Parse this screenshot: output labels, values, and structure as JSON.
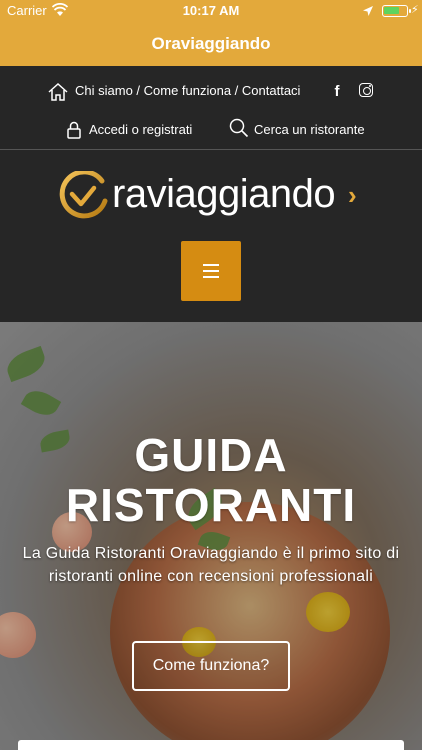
{
  "status_bar": {
    "carrier": "Carrier",
    "time": "10:17 AM"
  },
  "nav": {
    "title": "Oraviaggiando"
  },
  "header": {
    "links": "Chi siamo / Come funziona / Contattaci",
    "login": "Accedi o registrati",
    "search": "Cerca un ristorante",
    "logo_text": "raviaggiando"
  },
  "hero": {
    "title_line1": "GUIDA",
    "title_line2": "RISTORANTI",
    "subtitle": "La Guida Ristoranti Oraviaggiando è il primo sito di ristoranti online con recensioni professionali",
    "cta": "Come funziona?"
  },
  "colors": {
    "gold": "#e3a93b",
    "menu_button": "#d58c12",
    "header_bg": "#262626"
  },
  "icons": [
    "wifi-icon",
    "location-arrow-icon",
    "battery-icon",
    "charging-bolt-icon",
    "home-icon",
    "facebook-icon",
    "instagram-icon",
    "lock-icon",
    "search-icon",
    "hamburger-menu-icon"
  ]
}
